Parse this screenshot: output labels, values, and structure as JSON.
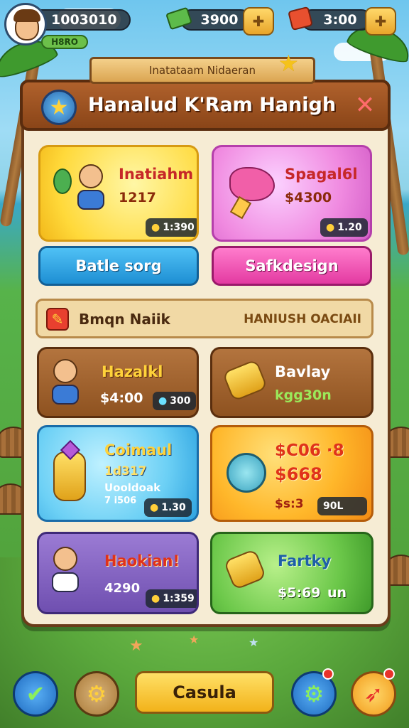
{
  "hud": {
    "coins": "1003010",
    "level_badge": "H8RO",
    "cash": "3900",
    "gifts": "3:00"
  },
  "banner": {
    "ribbon_text": "Inatataam Nidaeran"
  },
  "header": {
    "title": "Hanalud K'Ram Hanigh"
  },
  "cards_top": [
    {
      "title": "Inatiahm",
      "value": "1217",
      "tag": "1:390"
    },
    {
      "title": "Spagal6l",
      "value": "$4300",
      "tag": "1.20"
    }
  ],
  "buttons_top": [
    {
      "label": "Batle sorg"
    },
    {
      "label": "Safkdesign"
    }
  ],
  "divider": {
    "left_text": "Bmqn Naiik",
    "right_text": "HANIUSH OACIAII"
  },
  "cards_mid": [
    {
      "title": "Hazalkl",
      "price": "$4:00",
      "tag": "300"
    },
    {
      "title": "Bavlay",
      "value": "kgg30n"
    }
  ],
  "cards_low": [
    {
      "title": "Coimaul",
      "value": "1d317",
      "sub1": "Uooldoak",
      "sub2": "7 i506",
      "tag": "1.30"
    },
    {
      "title": "$C06 ·8",
      "value": "$668",
      "price": "$s:3",
      "tag": "90L"
    }
  ],
  "cards_bottom": [
    {
      "title": "Haokian!",
      "value": "4290",
      "tag": "1:359"
    },
    {
      "title": "Fartky",
      "price": "$5:69",
      "suffix": "un"
    }
  ],
  "footer": {
    "main_button": "Casula"
  },
  "colors": {
    "panel_bg": "#f6ecd4",
    "header_brown": "#8a4518",
    "accent_yellow": "#ffd23a",
    "blue_button": "#2ea3e0",
    "pink_button": "#f24fb4"
  }
}
